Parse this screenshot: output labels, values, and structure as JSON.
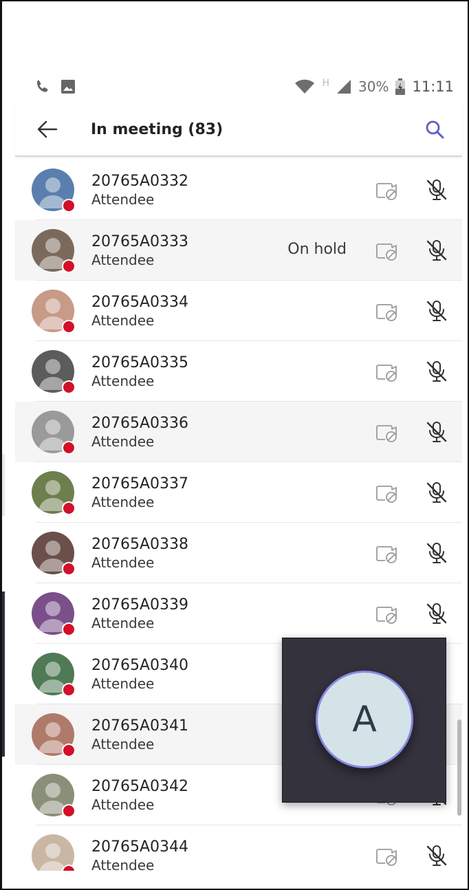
{
  "status_bar": {
    "network_label": "H",
    "battery": "30%",
    "time": "11:11"
  },
  "header": {
    "title": "In meeting (83)"
  },
  "participants": [
    {
      "name": "20765A0332",
      "role": "Attendee",
      "status": "",
      "avatar_color": "#5a7fae"
    },
    {
      "name": "20765A0333",
      "role": "Attendee",
      "status": "On hold",
      "avatar_color": "#7b6a5c"
    },
    {
      "name": "20765A0334",
      "role": "Attendee",
      "status": "",
      "avatar_color": "#c89a88"
    },
    {
      "name": "20765A0335",
      "role": "Attendee",
      "status": "",
      "avatar_color": "#5c5c5c"
    },
    {
      "name": "20765A0336",
      "role": "Attendee",
      "status": "",
      "avatar_color": "#9a9a9a"
    },
    {
      "name": "20765A0337",
      "role": "Attendee",
      "status": "",
      "avatar_color": "#6e7f4e"
    },
    {
      "name": "20765A0338",
      "role": "Attendee",
      "status": "",
      "avatar_color": "#6a4f4a"
    },
    {
      "name": "20765A0339",
      "role": "Attendee",
      "status": "",
      "avatar_color": "#7a4f8a"
    },
    {
      "name": "20765A0340",
      "role": "Attendee",
      "status": "",
      "avatar_color": "#4f7a55"
    },
    {
      "name": "20765A0341",
      "role": "Attendee",
      "status": "",
      "avatar_color": "#b07a6a"
    },
    {
      "name": "20765A0342",
      "role": "Attendee",
      "status": "",
      "avatar_color": "#8a8f7a"
    },
    {
      "name": "20765A0344",
      "role": "Attendee",
      "status": "",
      "avatar_color": "#c9b7a3"
    }
  ],
  "video_tile": {
    "initial": "A"
  },
  "colors": {
    "accent": "#5b5fc7",
    "presence_busy": "#d2102a",
    "tile_background": "#33323d"
  }
}
